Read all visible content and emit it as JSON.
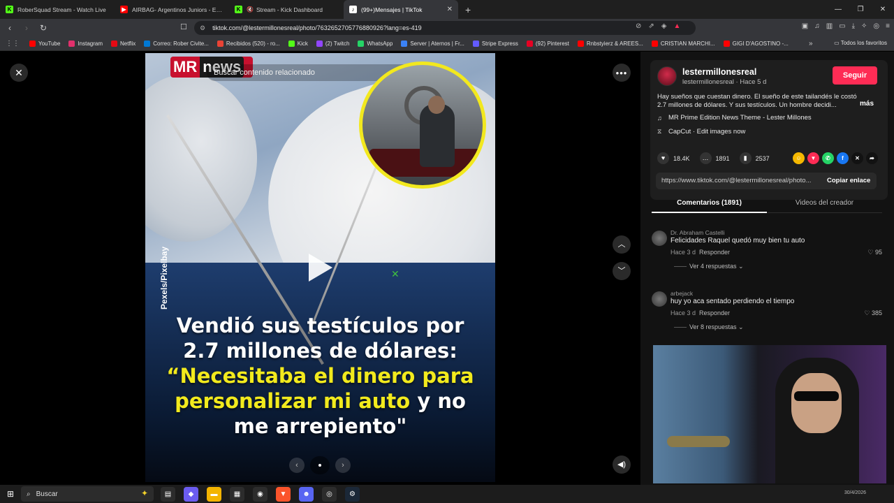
{
  "browser": {
    "tabs": [
      {
        "title": "RoberSquad Stream - Watch Live",
        "favicon_color": "#53fc18",
        "muted": false
      },
      {
        "title": "AIRBAG- Argentinos Juniors - EN VIVO",
        "favicon_color": "#ff0000",
        "muted": true
      },
      {
        "title": "Stream - Kick Dashboard",
        "favicon_color": "#53fc18",
        "muted": true
      },
      {
        "title": "(99+)Mensajes | TikTok",
        "favicon_color": "#ffffff",
        "muted": false,
        "active": true
      }
    ],
    "url": "tiktok.com/@lestermillonesreal/photo/7632652705776880926?lang=es-419",
    "bookmarks": [
      {
        "label": "YouTube",
        "color": "#ff0000"
      },
      {
        "label": "Instagram",
        "color": "#e1306c"
      },
      {
        "label": "Netflix",
        "color": "#e50914"
      },
      {
        "label": "Correo: Rober Civite...",
        "color": "#0078d4"
      },
      {
        "label": "Recibidos (520) - ro...",
        "color": "#ea4335"
      },
      {
        "label": "Kick",
        "color": "#53fc18"
      },
      {
        "label": "(2) Twitch",
        "color": "#9146ff"
      },
      {
        "label": "WhatsApp",
        "color": "#25d366"
      },
      {
        "label": "Server | Aternos | Fr...",
        "color": "#3b82f6"
      },
      {
        "label": "Stripe Express",
        "color": "#635bff"
      },
      {
        "label": "(92) Pinterest",
        "color": "#e60023"
      },
      {
        "label": "Rnbstyierz & AREES...",
        "color": "#ff0000"
      },
      {
        "label": "CRISTIAN MARCHI...",
        "color": "#ff0000"
      },
      {
        "label": "GIGI D'AGOSTINO -...",
        "color": "#ff0000"
      }
    ],
    "all_bookmarks_label": "Todos los favoritos"
  },
  "media": {
    "brand_mr": "MR",
    "brand_news": "news",
    "search_placeholder": "Buscar contenido relacionado",
    "watermark": "Pexels/Pixelbay",
    "headline_white_1": "Vendió sus testículos por 2.7 millones de dólares: ",
    "headline_yellow": "“Necesitaba el dinero para personalizar mi auto",
    "headline_white_2": " y no me arrepiento\""
  },
  "post": {
    "username": "lestermillonesreal",
    "subline": "lestermillonesreal · Hace 5 d",
    "follow_label": "Seguir",
    "description": "Hay sueños que cuestan dinero. El sueño de este tailandés le costó 2.7 millones de dólares. Y sus testículos. Un hombre decidi...",
    "more_label": "más",
    "music": "MR Prime Edition News Theme - Lester Millones",
    "capcut": "CapCut · Edit images now",
    "likes": "18.4K",
    "comments": "1891",
    "saves": "2537",
    "link": "https://www.tiktok.com/@lestermillonesreal/photo...",
    "copy_label": "Copiar enlace"
  },
  "tabs": {
    "comments": "Comentarios (1891)",
    "videos": "Videos del creador"
  },
  "comments": [
    {
      "name": "Dr. Abraham Castelli",
      "text": "Felicidades Raquel quedó muy bien tu auto",
      "time": "Hace 3 d",
      "reply": "Responder",
      "likes": "95",
      "replies": "Ver 4 respuestas"
    },
    {
      "name": "arbejack",
      "text": "huy yo aca sentado perdiendo el tiempo",
      "time": "Hace 3 d",
      "reply": "Responder",
      "likes": "385",
      "replies": "Ver 8 respuestas"
    }
  ],
  "taskbar": {
    "search_label": "Buscar",
    "date": "30/4/2026"
  }
}
